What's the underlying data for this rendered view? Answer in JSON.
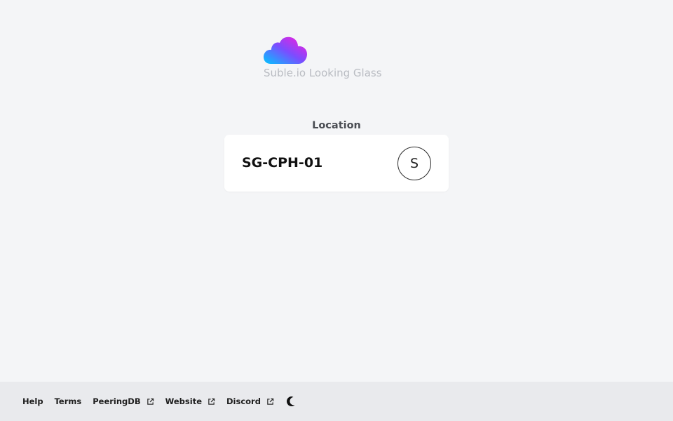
{
  "brand": {
    "title": "Suble.io Looking Glass",
    "logo_icon": "cloud-icon",
    "gradient": [
      "#00c6ff",
      "#7b4dff",
      "#ff1ad9"
    ]
  },
  "location": {
    "label": "Location",
    "selected": {
      "name": "SG-CPH-01",
      "avatar_letter": "S"
    }
  },
  "footer": {
    "links": [
      {
        "label": "Help",
        "external": false
      },
      {
        "label": "Terms",
        "external": false
      },
      {
        "label": "PeeringDB",
        "external": true,
        "icon": "external-link-icon"
      },
      {
        "label": "Website",
        "external": true,
        "icon": "external-link-icon"
      },
      {
        "label": "Discord",
        "external": true,
        "icon": "external-link-icon"
      }
    ],
    "theme_toggle_icon": "moon-icon"
  }
}
